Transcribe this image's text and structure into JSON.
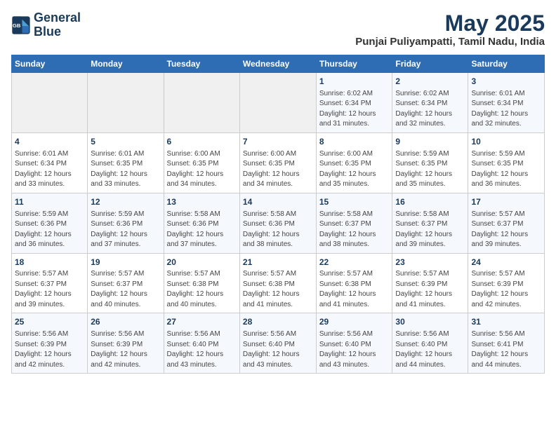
{
  "header": {
    "logo_line1": "General",
    "logo_line2": "Blue",
    "month_year": "May 2025",
    "location": "Punjai Puliyampatti, Tamil Nadu, India"
  },
  "weekdays": [
    "Sunday",
    "Monday",
    "Tuesday",
    "Wednesday",
    "Thursday",
    "Friday",
    "Saturday"
  ],
  "weeks": [
    [
      {
        "day": "",
        "sunrise": "",
        "sunset": "",
        "daylight": ""
      },
      {
        "day": "",
        "sunrise": "",
        "sunset": "",
        "daylight": ""
      },
      {
        "day": "",
        "sunrise": "",
        "sunset": "",
        "daylight": ""
      },
      {
        "day": "",
        "sunrise": "",
        "sunset": "",
        "daylight": ""
      },
      {
        "day": "1",
        "sunrise": "Sunrise: 6:02 AM",
        "sunset": "Sunset: 6:34 PM",
        "daylight": "Daylight: 12 hours and 31 minutes."
      },
      {
        "day": "2",
        "sunrise": "Sunrise: 6:02 AM",
        "sunset": "Sunset: 6:34 PM",
        "daylight": "Daylight: 12 hours and 32 minutes."
      },
      {
        "day": "3",
        "sunrise": "Sunrise: 6:01 AM",
        "sunset": "Sunset: 6:34 PM",
        "daylight": "Daylight: 12 hours and 32 minutes."
      }
    ],
    [
      {
        "day": "4",
        "sunrise": "Sunrise: 6:01 AM",
        "sunset": "Sunset: 6:34 PM",
        "daylight": "Daylight: 12 hours and 33 minutes."
      },
      {
        "day": "5",
        "sunrise": "Sunrise: 6:01 AM",
        "sunset": "Sunset: 6:35 PM",
        "daylight": "Daylight: 12 hours and 33 minutes."
      },
      {
        "day": "6",
        "sunrise": "Sunrise: 6:00 AM",
        "sunset": "Sunset: 6:35 PM",
        "daylight": "Daylight: 12 hours and 34 minutes."
      },
      {
        "day": "7",
        "sunrise": "Sunrise: 6:00 AM",
        "sunset": "Sunset: 6:35 PM",
        "daylight": "Daylight: 12 hours and 34 minutes."
      },
      {
        "day": "8",
        "sunrise": "Sunrise: 6:00 AM",
        "sunset": "Sunset: 6:35 PM",
        "daylight": "Daylight: 12 hours and 35 minutes."
      },
      {
        "day": "9",
        "sunrise": "Sunrise: 5:59 AM",
        "sunset": "Sunset: 6:35 PM",
        "daylight": "Daylight: 12 hours and 35 minutes."
      },
      {
        "day": "10",
        "sunrise": "Sunrise: 5:59 AM",
        "sunset": "Sunset: 6:35 PM",
        "daylight": "Daylight: 12 hours and 36 minutes."
      }
    ],
    [
      {
        "day": "11",
        "sunrise": "Sunrise: 5:59 AM",
        "sunset": "Sunset: 6:36 PM",
        "daylight": "Daylight: 12 hours and 36 minutes."
      },
      {
        "day": "12",
        "sunrise": "Sunrise: 5:59 AM",
        "sunset": "Sunset: 6:36 PM",
        "daylight": "Daylight: 12 hours and 37 minutes."
      },
      {
        "day": "13",
        "sunrise": "Sunrise: 5:58 AM",
        "sunset": "Sunset: 6:36 PM",
        "daylight": "Daylight: 12 hours and 37 minutes."
      },
      {
        "day": "14",
        "sunrise": "Sunrise: 5:58 AM",
        "sunset": "Sunset: 6:36 PM",
        "daylight": "Daylight: 12 hours and 38 minutes."
      },
      {
        "day": "15",
        "sunrise": "Sunrise: 5:58 AM",
        "sunset": "Sunset: 6:37 PM",
        "daylight": "Daylight: 12 hours and 38 minutes."
      },
      {
        "day": "16",
        "sunrise": "Sunrise: 5:58 AM",
        "sunset": "Sunset: 6:37 PM",
        "daylight": "Daylight: 12 hours and 39 minutes."
      },
      {
        "day": "17",
        "sunrise": "Sunrise: 5:57 AM",
        "sunset": "Sunset: 6:37 PM",
        "daylight": "Daylight: 12 hours and 39 minutes."
      }
    ],
    [
      {
        "day": "18",
        "sunrise": "Sunrise: 5:57 AM",
        "sunset": "Sunset: 6:37 PM",
        "daylight": "Daylight: 12 hours and 39 minutes."
      },
      {
        "day": "19",
        "sunrise": "Sunrise: 5:57 AM",
        "sunset": "Sunset: 6:37 PM",
        "daylight": "Daylight: 12 hours and 40 minutes."
      },
      {
        "day": "20",
        "sunrise": "Sunrise: 5:57 AM",
        "sunset": "Sunset: 6:38 PM",
        "daylight": "Daylight: 12 hours and 40 minutes."
      },
      {
        "day": "21",
        "sunrise": "Sunrise: 5:57 AM",
        "sunset": "Sunset: 6:38 PM",
        "daylight": "Daylight: 12 hours and 41 minutes."
      },
      {
        "day": "22",
        "sunrise": "Sunrise: 5:57 AM",
        "sunset": "Sunset: 6:38 PM",
        "daylight": "Daylight: 12 hours and 41 minutes."
      },
      {
        "day": "23",
        "sunrise": "Sunrise: 5:57 AM",
        "sunset": "Sunset: 6:39 PM",
        "daylight": "Daylight: 12 hours and 41 minutes."
      },
      {
        "day": "24",
        "sunrise": "Sunrise: 5:57 AM",
        "sunset": "Sunset: 6:39 PM",
        "daylight": "Daylight: 12 hours and 42 minutes."
      }
    ],
    [
      {
        "day": "25",
        "sunrise": "Sunrise: 5:56 AM",
        "sunset": "Sunset: 6:39 PM",
        "daylight": "Daylight: 12 hours and 42 minutes."
      },
      {
        "day": "26",
        "sunrise": "Sunrise: 5:56 AM",
        "sunset": "Sunset: 6:39 PM",
        "daylight": "Daylight: 12 hours and 42 minutes."
      },
      {
        "day": "27",
        "sunrise": "Sunrise: 5:56 AM",
        "sunset": "Sunset: 6:40 PM",
        "daylight": "Daylight: 12 hours and 43 minutes."
      },
      {
        "day": "28",
        "sunrise": "Sunrise: 5:56 AM",
        "sunset": "Sunset: 6:40 PM",
        "daylight": "Daylight: 12 hours and 43 minutes."
      },
      {
        "day": "29",
        "sunrise": "Sunrise: 5:56 AM",
        "sunset": "Sunset: 6:40 PM",
        "daylight": "Daylight: 12 hours and 43 minutes."
      },
      {
        "day": "30",
        "sunrise": "Sunrise: 5:56 AM",
        "sunset": "Sunset: 6:40 PM",
        "daylight": "Daylight: 12 hours and 44 minutes."
      },
      {
        "day": "31",
        "sunrise": "Sunrise: 5:56 AM",
        "sunset": "Sunset: 6:41 PM",
        "daylight": "Daylight: 12 hours and 44 minutes."
      }
    ]
  ]
}
